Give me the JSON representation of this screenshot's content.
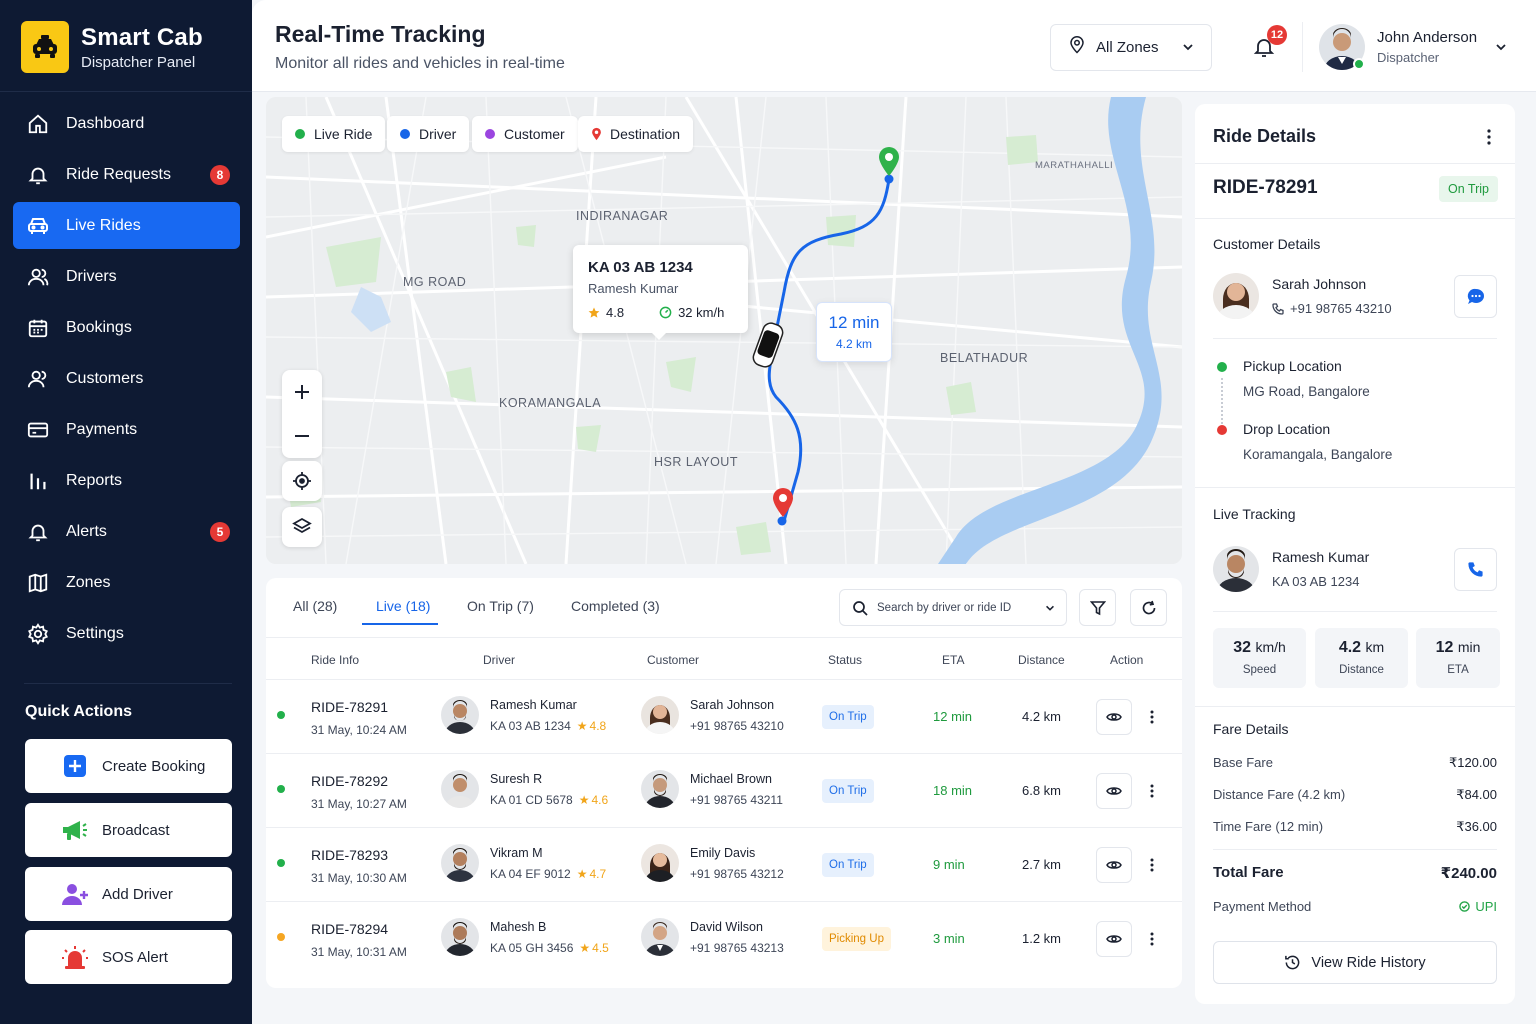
{
  "brand": {
    "title": "Smart Cab",
    "subtitle": "Dispatcher Panel"
  },
  "nav": [
    {
      "label": "Dashboard",
      "icon": "home-icon"
    },
    {
      "label": "Ride Requests",
      "icon": "bell-icon",
      "badge": "8"
    },
    {
      "label": "Live Rides",
      "icon": "car-icon",
      "active": true
    },
    {
      "label": "Drivers",
      "icon": "users-icon"
    },
    {
      "label": "Bookings",
      "icon": "calendar-icon"
    },
    {
      "label": "Customers",
      "icon": "customers-icon"
    },
    {
      "label": "Payments",
      "icon": "card-icon"
    },
    {
      "label": "Reports",
      "icon": "bar-chart-icon"
    },
    {
      "label": "Alerts",
      "icon": "alert-bell-icon",
      "badge": "5"
    },
    {
      "label": "Zones",
      "icon": "map-icon"
    },
    {
      "label": "Settings",
      "icon": "gear-icon"
    }
  ],
  "quick_actions": {
    "title": "Quick Actions",
    "items": [
      {
        "label": "Create Booking",
        "icon": "plus-square-icon"
      },
      {
        "label": "Broadcast",
        "icon": "megaphone-icon"
      },
      {
        "label": "Add Driver",
        "icon": "add-user-icon"
      },
      {
        "label": "SOS Alert",
        "icon": "siren-icon"
      }
    ]
  },
  "header": {
    "title": "Real-Time Tracking",
    "subtitle": "Monitor all rides and vehicles in real-time",
    "zone_select": "All Zones",
    "notification_count": "12",
    "user_name": "John Anderson",
    "user_role": "Dispatcher"
  },
  "map": {
    "legend": [
      {
        "label": "Live Ride",
        "color": "#22b04b"
      },
      {
        "label": "Driver",
        "color": "#1765e8"
      },
      {
        "label": "Customer",
        "color": "#9b45e0"
      },
      {
        "label": "Destination",
        "color": "#e53935"
      }
    ],
    "areas": [
      "INDIRANAGAR",
      "MG ROAD",
      "KORAMANGALA",
      "HSR LAYOUT",
      "BELATHADUR",
      "MARATHAHALLI"
    ],
    "vehicle": {
      "plate": "KA 03 AB 1234",
      "driver": "Ramesh Kumar",
      "rating": "4.8",
      "speed": "32 km/h"
    },
    "eta": {
      "time": "12 min",
      "distance": "4.2 km"
    }
  },
  "rides": {
    "tabs": [
      "All (28)",
      "Live (18)",
      "On Trip (7)",
      "Completed (3)"
    ],
    "active_tab": "Live (18)",
    "search_placeholder": "Search by driver or ride ID",
    "columns": [
      "Ride Info",
      "Driver",
      "Customer",
      "Status",
      "ETA",
      "Distance",
      "Action"
    ],
    "rows": [
      {
        "id": "RIDE-78291",
        "time": "31 May, 10:24 AM",
        "driver": "Ramesh Kumar",
        "plate": "KA 03 AB 1234",
        "rating": "4.8",
        "customer": "Sarah Johnson",
        "phone": "+91 98765 43210",
        "status": "On Trip",
        "eta": "12 min",
        "distance": "4.2 km",
        "dot": "#22b04b"
      },
      {
        "id": "RIDE-78292",
        "time": "31 May, 10:27 AM",
        "driver": "Suresh R",
        "plate": "KA 01 CD 5678",
        "rating": "4.6",
        "customer": "Michael Brown",
        "phone": "+91 98765 43211",
        "status": "On Trip",
        "eta": "18 min",
        "distance": "6.8 km",
        "dot": "#22b04b"
      },
      {
        "id": "RIDE-78293",
        "time": "31 May, 10:30 AM",
        "driver": "Vikram M",
        "plate": "KA 04 EF 9012",
        "rating": "4.7",
        "customer": "Emily Davis",
        "phone": "+91 98765 43212",
        "status": "On Trip",
        "eta": "9 min",
        "distance": "2.7 km",
        "dot": "#22b04b"
      },
      {
        "id": "RIDE-78294",
        "time": "31 May, 10:31 AM",
        "driver": "Mahesh B",
        "plate": "KA 05 GH 3456",
        "rating": "4.5",
        "customer": "David Wilson",
        "phone": "+91 98765 43213",
        "status": "Picking Up",
        "eta": "3 min",
        "distance": "1.2 km",
        "dot": "#f5a623"
      }
    ]
  },
  "details": {
    "title": "Ride Details",
    "ride_id": "RIDE-78291",
    "status": "On Trip",
    "customer_title": "Customer Details",
    "customer_name": "Sarah Johnson",
    "customer_phone": "+91 98765 43210",
    "pickup_title": "Pickup Location",
    "pickup": "MG Road, Bangalore",
    "drop_title": "Drop Location",
    "drop": "Koramangala, Bangalore",
    "tracking_title": "Live Tracking",
    "driver_name": "Ramesh Kumar",
    "driver_plate": "KA 03 AB 1234",
    "stats": [
      {
        "value": "32",
        "unit": "km/h",
        "label": "Speed"
      },
      {
        "value": "4.2",
        "unit": "km",
        "label": "Distance"
      },
      {
        "value": "12",
        "unit": "min",
        "label": "ETA"
      }
    ],
    "fare_title": "Fare Details",
    "fares": [
      {
        "label": "Base Fare",
        "value": "₹120.00"
      },
      {
        "label": "Distance Fare (4.2 km)",
        "value": "₹84.00"
      },
      {
        "label": "Time Fare (12 min)",
        "value": "₹36.00"
      }
    ],
    "total_label": "Total Fare",
    "total_value": "₹240.00",
    "payment_label": "Payment Method",
    "payment_value": "UPI",
    "history_button": "View Ride History"
  }
}
